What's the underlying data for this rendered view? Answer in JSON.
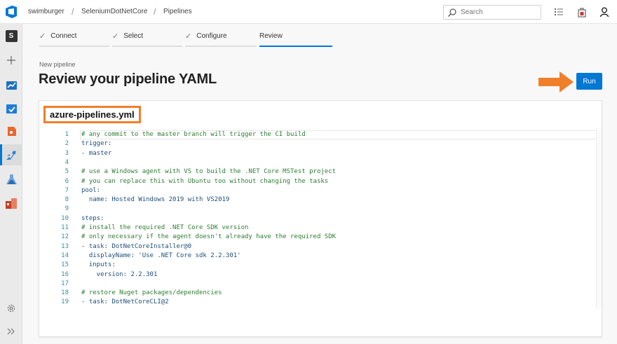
{
  "colors": {
    "accent": "#0078d4",
    "highlight": "#f07f2a"
  },
  "header": {
    "breadcrumbs": [
      "swimburger",
      "SeleniumDotNetCore",
      "Pipelines"
    ],
    "search_placeholder": "Search"
  },
  "rail": {
    "project_initial": "S",
    "icons": [
      "add-icon",
      "overview-icon",
      "boards-icon",
      "repos-icon",
      "pipelines-icon",
      "test-plans-icon",
      "artifacts-icon",
      "settings-icon",
      "collapse-icon"
    ]
  },
  "wizard": {
    "tabs": [
      {
        "label": "Connect",
        "done": true
      },
      {
        "label": "Select",
        "done": true
      },
      {
        "label": "Configure",
        "done": true
      },
      {
        "label": "Review",
        "done": false,
        "active": true
      }
    ]
  },
  "page": {
    "subtitle": "New pipeline",
    "title": "Review your pipeline YAML",
    "run_label": "Run"
  },
  "editor": {
    "file_name": "azure-pipelines.yml",
    "lines": [
      {
        "n": "1",
        "text": "# any commit to the master branch will trigger the CI build",
        "kind": "cmt"
      },
      {
        "n": "2",
        "text": "trigger:",
        "kind": "key"
      },
      {
        "n": "3",
        "text": "- master",
        "kind": "key"
      },
      {
        "n": "4",
        "text": "",
        "kind": "key"
      },
      {
        "n": "5",
        "text": "# use a Windows agent with VS to build the .NET Core MSTest project",
        "kind": "cmt"
      },
      {
        "n": "6",
        "text": "# you can replace this with Ubuntu too without changing the tasks",
        "kind": "cmt"
      },
      {
        "n": "7",
        "text": "pool:",
        "kind": "key"
      },
      {
        "n": "8",
        "text": "  name: Hosted Windows 2019 with VS2019",
        "kind": "key"
      },
      {
        "n": "9",
        "text": "",
        "kind": "key"
      },
      {
        "n": "10",
        "text": "steps:",
        "kind": "key"
      },
      {
        "n": "11",
        "text": "# install the required .NET Core SDK version",
        "kind": "cmt"
      },
      {
        "n": "12",
        "text": "# only necessary if the agent doesn't already have the required SDK",
        "kind": "cmt"
      },
      {
        "n": "13",
        "text": "- task: DotNetCoreInstaller@0",
        "kind": "key"
      },
      {
        "n": "14",
        "text": "  displayName: 'Use .NET Core sdk 2.2.301'",
        "kind": "str"
      },
      {
        "n": "15",
        "text": "  inputs:",
        "kind": "key"
      },
      {
        "n": "16",
        "text": "    version: 2.2.301",
        "kind": "key"
      },
      {
        "n": "17",
        "text": "",
        "kind": "key"
      },
      {
        "n": "18",
        "text": "# restore Nuget packages/dependencies",
        "kind": "cmt"
      },
      {
        "n": "19",
        "text": "- task: DotNetCoreCLI@2",
        "kind": "key"
      }
    ]
  }
}
